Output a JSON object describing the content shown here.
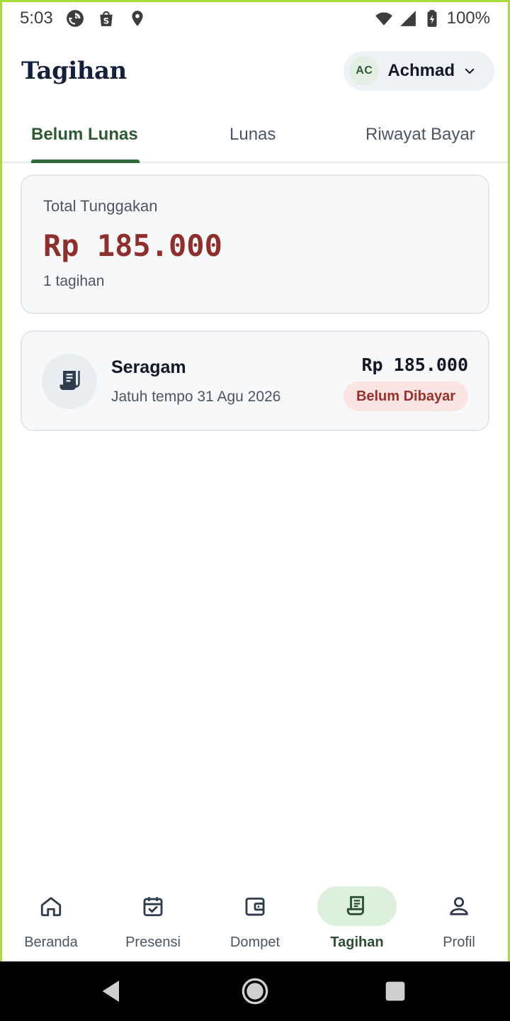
{
  "status_bar": {
    "time": "5:03",
    "battery": "100%",
    "icons": [
      "pocket-casts-icon",
      "shopee-icon",
      "location-icon",
      "wifi-icon",
      "signal-icon",
      "battery-icon"
    ]
  },
  "header": {
    "title": "Tagihan",
    "user_initials": "AC",
    "user_name": "Achmad"
  },
  "tabs": [
    {
      "label": "Belum Lunas",
      "active": true
    },
    {
      "label": "Lunas",
      "active": false
    },
    {
      "label": "Riwayat Bayar",
      "active": false
    }
  ],
  "summary": {
    "label": "Total Tunggakan",
    "amount": "Rp 185.000",
    "count": "1 tagihan"
  },
  "bills": [
    {
      "icon": "receipt-icon",
      "name": "Seragam",
      "due": "Jatuh tempo 31 Agu 2026",
      "amount": "Rp 185.000",
      "status": "Belum Dibayar"
    }
  ],
  "bottom_nav": [
    {
      "label": "Beranda",
      "icon": "home-icon",
      "active": false
    },
    {
      "label": "Presensi",
      "icon": "calendar-check-icon",
      "active": false
    },
    {
      "label": "Dompet",
      "icon": "wallet-icon",
      "active": false
    },
    {
      "label": "Tagihan",
      "icon": "receipt-icon",
      "active": true
    },
    {
      "label": "Profil",
      "icon": "user-icon",
      "active": false
    }
  ],
  "colors": {
    "accent_green": "#2e5a33",
    "amount_red": "#8e2f2c",
    "badge_bg": "#fbe4e2",
    "active_nav_bg": "#ddefdd",
    "frame_border": "#a6dc3c"
  }
}
